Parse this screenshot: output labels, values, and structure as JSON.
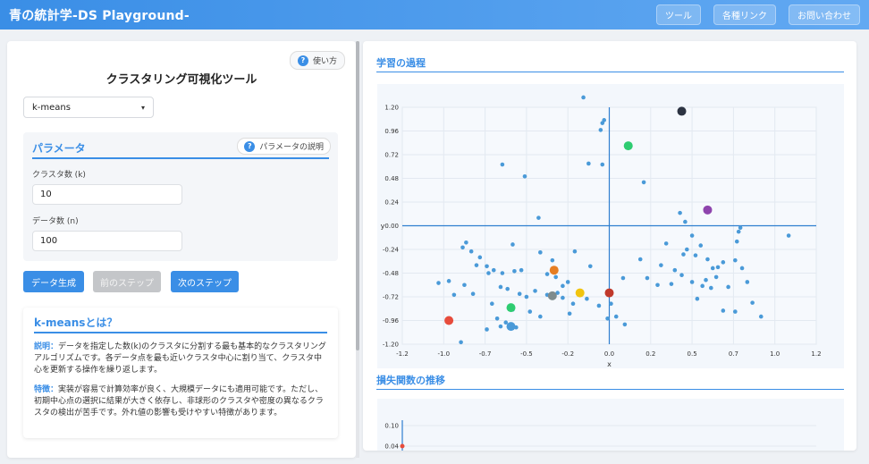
{
  "header": {
    "brand": "青の統計学-DS Playground-",
    "nav": [
      "ツール",
      "各種リンク",
      "お問い合わせ"
    ]
  },
  "left": {
    "help_label": "使い方",
    "title": "クラスタリング可視化ツール",
    "algorithm": "k-means",
    "params": {
      "heading": "パラメータ",
      "help_label": "パラメータの説明",
      "k_label": "クラスタ数 (k)",
      "k_value": "10",
      "n_label": "データ数 (n)",
      "n_value": "100"
    },
    "buttons": {
      "generate": "データ生成",
      "prev": "前のステップ",
      "next": "次のステップ"
    },
    "about": {
      "heading": "k-meansとは？",
      "desc_label": "説明：",
      "desc_text": "データを指定した数(k)のクラスタに分割する最も基本的なクラスタリングアルゴリズムです。各データ点を最も近いクラスタ中心に割り当て、クラスタ中心を更新する操作を繰り返します。",
      "feature_label": "特徴：",
      "feature_text": "実装が容易で計算効率が良く、大規模データにも適用可能です。ただし、初期中心点の選択に結果が大きく依存し、非球形のクラスタや密度の異なるクラスタの検出が苦手です。外れ値の影響も受けやすい特徴があります。"
    }
  },
  "right": {
    "learning_title": "学習の過程",
    "loss_title": "損失関数の推移"
  },
  "chart_data": [
    {
      "type": "scatter",
      "title": "",
      "xlabel": "x",
      "ylabel": "y",
      "xlim": [
        -1.2,
        1.2
      ],
      "ylim": [
        -1.2,
        1.2
      ],
      "xticks": [
        "-1.2",
        "-1.0",
        "-0.7",
        "-0.5",
        "-0.2",
        "0.0",
        "0.2",
        "0.5",
        "0.7",
        "1.0",
        "1.2"
      ],
      "yticks": [
        "1.20",
        "0.96",
        "0.72",
        "0.48",
        "0.24",
        "0.00",
        "-0.24",
        "-0.48",
        "-0.72",
        "-0.96",
        "-1.20"
      ],
      "grid": true,
      "point_color": "#4a9ad8",
      "points": [
        [
          -0.15,
          1.3
        ],
        [
          -0.05,
          0.97
        ],
        [
          -0.04,
          1.04
        ],
        [
          -0.03,
          1.07
        ],
        [
          -0.62,
          0.62
        ],
        [
          -0.49,
          0.5
        ],
        [
          -0.12,
          0.63
        ],
        [
          -0.04,
          0.62
        ],
        [
          0.2,
          0.44
        ],
        [
          -0.41,
          0.08
        ],
        [
          -0.83,
          -0.17
        ],
        [
          -0.8,
          -0.26
        ],
        [
          -0.75,
          -0.32
        ],
        [
          -0.56,
          -0.19
        ],
        [
          -0.4,
          -0.27
        ],
        [
          -0.33,
          -0.35
        ],
        [
          -0.2,
          -0.26
        ],
        [
          -0.85,
          -0.22
        ],
        [
          -0.77,
          -0.4
        ],
        [
          -0.71,
          -0.41
        ],
        [
          -0.67,
          -0.45
        ],
        [
          -0.62,
          -0.48
        ],
        [
          -0.55,
          -0.46
        ],
        [
          -0.51,
          -0.45
        ],
        [
          -0.36,
          -0.49
        ],
        [
          -0.31,
          -0.52
        ],
        [
          -0.27,
          -0.61
        ],
        [
          -0.24,
          -0.57
        ],
        [
          -0.99,
          -0.58
        ],
        [
          -0.9,
          -0.7
        ],
        [
          -0.84,
          -0.6
        ],
        [
          -0.79,
          -0.69
        ],
        [
          -0.63,
          -0.62
        ],
        [
          -0.59,
          -0.64
        ],
        [
          -0.52,
          -0.69
        ],
        [
          -0.48,
          -0.72
        ],
        [
          -0.43,
          -0.66
        ],
        [
          -0.36,
          -0.7
        ],
        [
          -0.3,
          -0.68
        ],
        [
          -0.27,
          -0.73
        ],
        [
          -0.21,
          -0.79
        ],
        [
          -0.4,
          -0.92
        ],
        [
          -0.46,
          -0.87
        ],
        [
          -0.56,
          -0.85
        ],
        [
          -0.6,
          -0.98
        ],
        [
          -0.63,
          -1.02
        ],
        [
          -0.54,
          -1.03
        ],
        [
          -0.65,
          -0.94
        ],
        [
          -0.23,
          -0.89
        ],
        [
          -0.13,
          -0.74
        ],
        [
          -0.06,
          -0.81
        ],
        [
          0.01,
          -0.79
        ],
        [
          0.04,
          -0.92
        ],
        [
          0.09,
          -1.0
        ],
        [
          -0.01,
          -0.94
        ],
        [
          -0.86,
          -1.18
        ],
        [
          -0.71,
          -1.05
        ],
        [
          -0.68,
          -0.79
        ],
        [
          0.22,
          -0.53
        ],
        [
          0.3,
          -0.4
        ],
        [
          0.38,
          -0.45
        ],
        [
          0.42,
          -0.5
        ],
        [
          0.48,
          -0.57
        ],
        [
          0.36,
          -0.59
        ],
        [
          0.45,
          -0.24
        ],
        [
          0.5,
          -0.3
        ],
        [
          0.53,
          -0.2
        ],
        [
          0.43,
          -0.29
        ],
        [
          0.57,
          -0.34
        ],
        [
          0.6,
          -0.43
        ],
        [
          0.63,
          -0.42
        ],
        [
          0.66,
          -0.37
        ],
        [
          0.73,
          -0.35
        ],
        [
          0.69,
          -0.62
        ],
        [
          0.51,
          -0.74
        ],
        [
          0.54,
          -0.61
        ],
        [
          0.59,
          -0.63
        ],
        [
          0.77,
          -0.43
        ],
        [
          0.8,
          -0.57
        ],
        [
          0.83,
          -0.78
        ],
        [
          0.74,
          -0.16
        ],
        [
          0.75,
          -0.06
        ],
        [
          0.76,
          -0.02
        ],
        [
          0.88,
          -0.92
        ],
        [
          0.73,
          -0.87
        ],
        [
          0.66,
          -0.86
        ],
        [
          0.41,
          0.13
        ],
        [
          0.44,
          0.04
        ],
        [
          0.48,
          -0.1
        ],
        [
          1.04,
          -0.1
        ],
        [
          -0.93,
          -0.56
        ],
        [
          -0.11,
          -0.41
        ],
        [
          0.18,
          -0.34
        ],
        [
          0.28,
          -0.6
        ],
        [
          0.62,
          -0.52
        ],
        [
          -0.7,
          -0.48
        ],
        [
          0.01,
          -0.69
        ],
        [
          0.08,
          -0.53
        ],
        [
          0.33,
          -0.18
        ],
        [
          0.56,
          -0.55
        ]
      ],
      "centroids": [
        {
          "x": 0.42,
          "y": 1.16,
          "color": "#2c3342"
        },
        {
          "x": 0.11,
          "y": 0.81,
          "color": "#2ecc71"
        },
        {
          "x": 0.57,
          "y": 0.16,
          "color": "#8e44ad"
        },
        {
          "x": -0.32,
          "y": -0.45,
          "color": "#e67e22"
        },
        {
          "x": -0.33,
          "y": -0.71,
          "color": "#7f8c8d"
        },
        {
          "x": -0.17,
          "y": -0.68,
          "color": "#f1c40f"
        },
        {
          "x": 0.0,
          "y": -0.68,
          "color": "#c0392b"
        },
        {
          "x": -0.57,
          "y": -0.83,
          "color": "#2ecc71"
        },
        {
          "x": -0.57,
          "y": -1.02,
          "color": "#4a9ad8"
        },
        {
          "x": -0.93,
          "y": -0.96,
          "color": "#e74c3c"
        }
      ]
    },
    {
      "type": "line",
      "title": "",
      "yticks": [
        "0.10",
        "0.04"
      ],
      "series": [
        {
          "values": [
            0.04
          ]
        }
      ]
    }
  ]
}
